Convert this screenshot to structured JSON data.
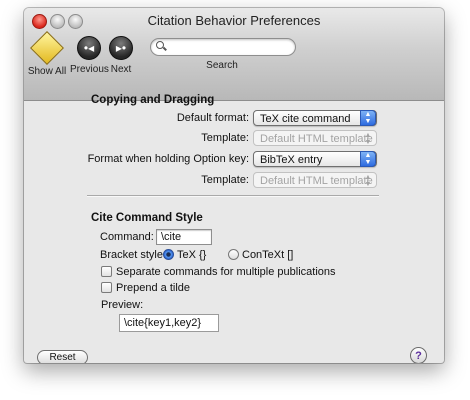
{
  "window": {
    "title": "Citation Behavior Preferences"
  },
  "toolbar": {
    "show_all": {
      "label": "Show All",
      "icon": "diamond-app-icon"
    },
    "previous": {
      "label": "Previous",
      "icon": "previous-icon",
      "glyph": "•◂"
    },
    "next": {
      "label": "Next",
      "icon": "next-icon",
      "glyph": "▸•"
    },
    "search": {
      "label": "Search",
      "placeholder": "",
      "value": ""
    }
  },
  "copying": {
    "heading": "Copying and Dragging",
    "default_format_label": "Default format:",
    "default_format_value": "TeX cite command",
    "template_label": "Template:",
    "template_value": "Default HTML template",
    "option_label": "Format when holding Option key:",
    "option_value": "BibTeX entry",
    "option_template_label": "Template:",
    "option_template_value": "Default HTML template"
  },
  "cite": {
    "heading": "Cite Command Style",
    "command_label": "Command:",
    "command_value": "\\cite",
    "bracket_label": "Bracket style:",
    "bracket_tex": "TeX {}",
    "bracket_context": "ConTeXt []",
    "separate_label": "Separate commands for multiple publications",
    "tilde_label": "Prepend a tilde",
    "preview_label": "Preview:",
    "preview_value": "\\cite{key1,key2}"
  },
  "footer": {
    "reset_label": "Reset",
    "help_label": "?"
  },
  "colors": {
    "accent": "#2d6be0",
    "window_bg": "#e8e8e8"
  }
}
